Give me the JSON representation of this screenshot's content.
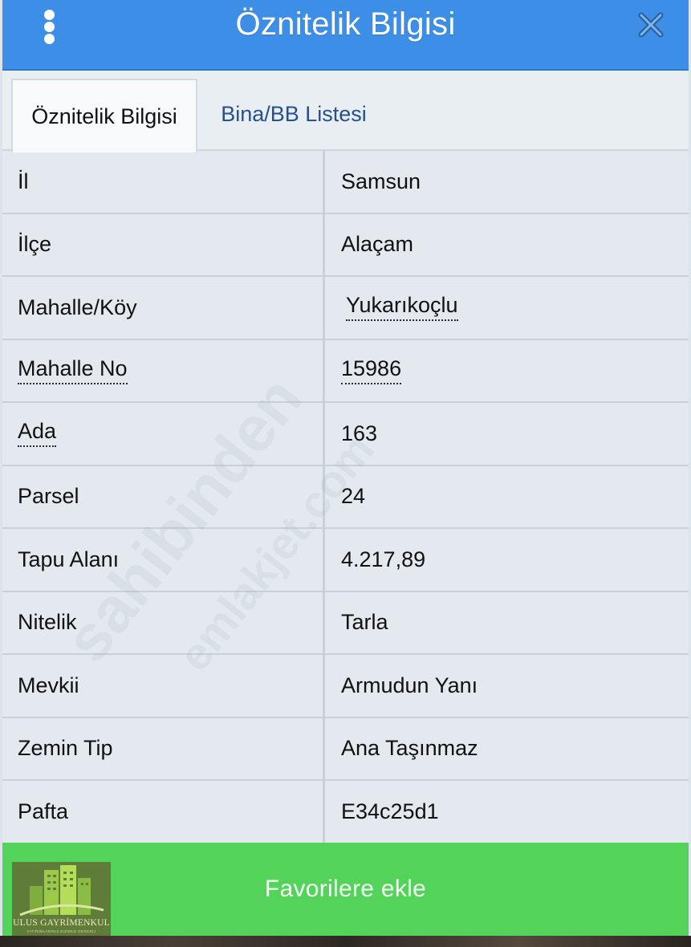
{
  "header": {
    "title": "Öznitelik Bilgisi",
    "menu_icon": "kebab-menu-icon",
    "close_icon": "close-icon",
    "color": "#3d8ee6"
  },
  "tabs": [
    {
      "label": "Öznitelik Bilgisi",
      "active": true
    },
    {
      "label": "Bina/BB Listesi",
      "active": false
    }
  ],
  "rows": [
    {
      "label": "İl",
      "value": "Samsun"
    },
    {
      "label": "İlçe",
      "value": "Alaçam"
    },
    {
      "label": "Mahalle/Köy",
      "value": "Yukarıkoçlu"
    },
    {
      "label": "Mahalle No",
      "value": "15986"
    },
    {
      "label": "Ada",
      "value": "163"
    },
    {
      "label": "Parsel",
      "value": "24"
    },
    {
      "label": "Tapu Alanı",
      "value": "4.217,89"
    },
    {
      "label": "Nitelik",
      "value": "Tarla"
    },
    {
      "label": "Mevkii",
      "value": "Armudun Yanı"
    },
    {
      "label": "Zemin Tip",
      "value": "Ana Taşınmaz"
    },
    {
      "label": "Pafta",
      "value": "E34c25d1"
    }
  ],
  "footer": {
    "button_label": "Favorilere ekle",
    "color": "#54d35a"
  },
  "logo": {
    "name": "ULUS GAYRİMENKUL",
    "tagline": "YATIRIMLARINIZ BİZİMLE DEĞERLİ"
  }
}
